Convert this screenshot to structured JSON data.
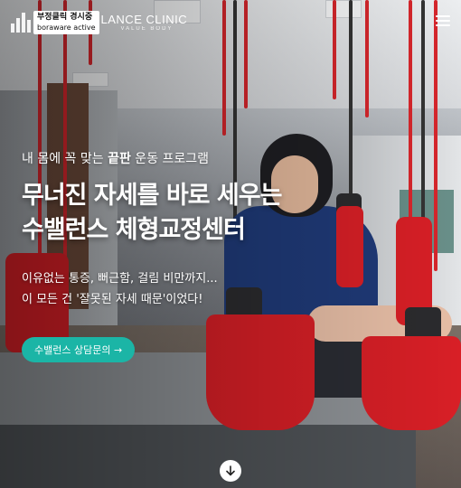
{
  "header": {
    "logo_badge_line1": "부정클릭 경시중",
    "logo_badge_line2": "boraware active",
    "logo_text": "LANCE CLINIC",
    "logo_subtext": "VALUE BODY",
    "menu_icon": "hamburger-menu-icon"
  },
  "hero": {
    "subtitle_before": "내 몸에 꼭 맞는 ",
    "subtitle_emphasis": "끝판",
    "subtitle_after": " 운동 프로그램",
    "headline_line1": "무너진 자세를 바로 세우는",
    "headline_line2": "수밸런스 체형교정센터",
    "desc_line1": "이유없는 통증, 뻐근함, 걸림 비만까지...",
    "desc_line2": "이 모든 건 '잘못된 자세 때문'이었다!",
    "cta_label": "수밸런스 상담문의 →",
    "scroll_icon": "arrow-down-circle-icon"
  },
  "colors": {
    "cta": "#1bb5a6",
    "sling": "#d81f26"
  }
}
